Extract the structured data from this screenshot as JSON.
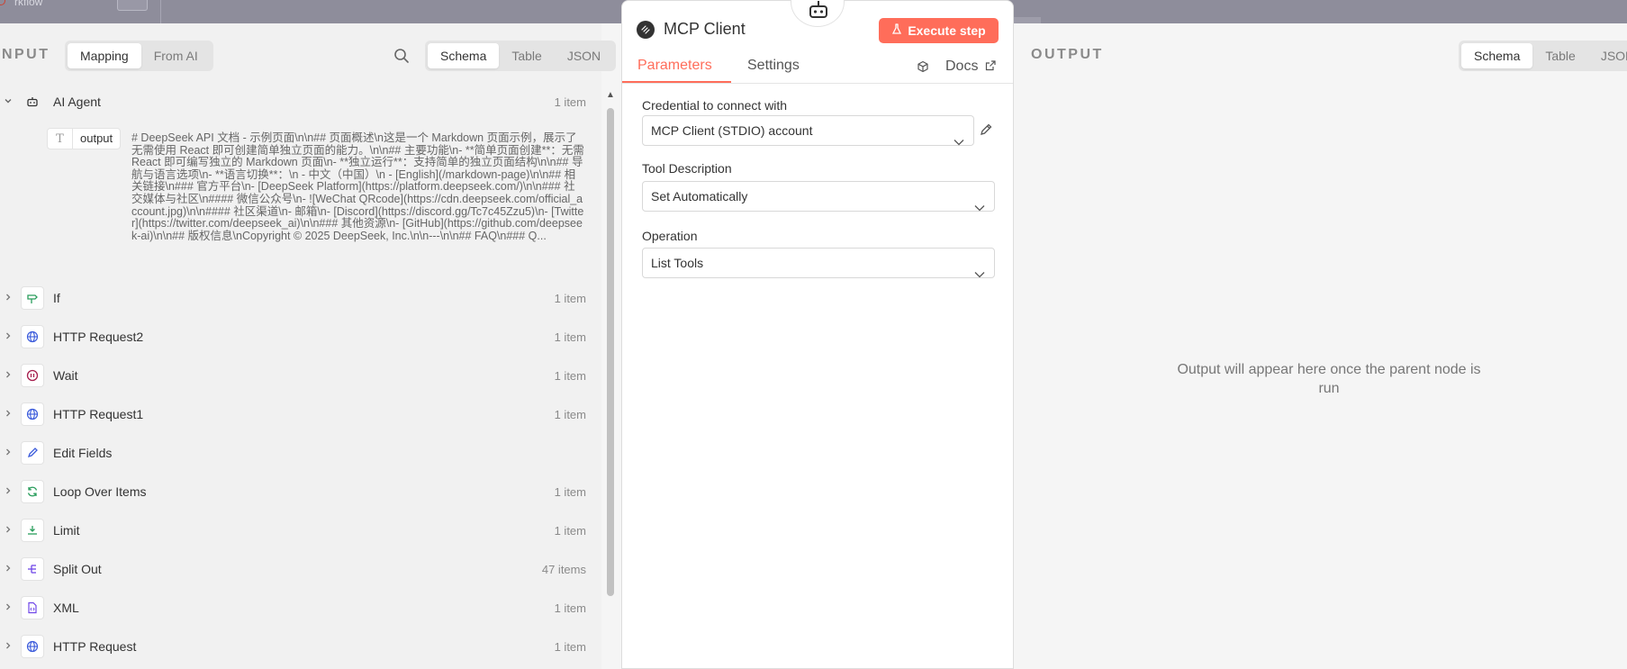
{
  "topbar": {
    "text": "rkflow"
  },
  "input_panel": {
    "label": "INPUT",
    "mode_tabs": [
      "Mapping",
      "From AI"
    ],
    "view_tabs": [
      "Schema",
      "Table",
      "JSON"
    ],
    "nodes": [
      {
        "name": "AI Agent",
        "count": "1 item",
        "icon": "robot-icon",
        "expanded": true
      },
      {
        "name": "If",
        "count": "1 item",
        "icon": "signpost-icon"
      },
      {
        "name": "HTTP Request2",
        "count": "1 item",
        "icon": "globe-icon"
      },
      {
        "name": "Wait",
        "count": "1 item",
        "icon": "pause-icon"
      },
      {
        "name": "HTTP Request1",
        "count": "1 item",
        "icon": "globe-icon"
      },
      {
        "name": "Edit Fields",
        "count": "",
        "icon": "pen-icon"
      },
      {
        "name": "Loop Over Items",
        "count": "1 item",
        "icon": "sync-icon"
      },
      {
        "name": "Limit",
        "count": "1 item",
        "icon": "limit-icon"
      },
      {
        "name": "Split Out",
        "count": "47 items",
        "icon": "split-icon"
      },
      {
        "name": "XML",
        "count": "1 item",
        "icon": "file-code-icon"
      },
      {
        "name": "HTTP Request",
        "count": "1 item",
        "icon": "globe-icon"
      }
    ],
    "output_field": {
      "type_glyph": "T",
      "name": "output",
      "value": "# DeepSeek API 文档 - 示例页面\\n\\n## 页面概述\\n这是一个 Markdown 页面示例，展示了无需使用 React 即可创建简单独立页面的能力。\\n\\n## 主要功能\\n- **简单页面创建**：无需 React 即可编写独立的 Markdown 页面\\n- **独立运行**：支持简单的独立页面结构\\n\\n## 导航与语言选项\\n- **语言切换**：\\n - 中文（中国）\\n - [English](/markdown-page)\\n\\n## 相关链接\\n### 官方平台\\n- [DeepSeek Platform](https://platform.deepseek.com/)\\n\\n### 社交媒体与社区\\n#### 微信公众号\\n- ![WeChat QRcode](https://cdn.deepseek.com/official_account.jpg)\\n\\n#### 社区渠道\\n- 邮箱\\n- [Discord](https://discord.gg/Tc7c45Zzu5)\\n- [Twitter](https://twitter.com/deepseek_ai)\\n\\n### 其他资源\\n- [GitHub](https://github.com/deepseek-ai)\\n\\n## 版权信息\\nCopyright © 2025 DeepSeek, Inc.\\n\\n---\\n\\n## FAQ\\n### Q..."
    }
  },
  "modal": {
    "title": "MCP Client",
    "execute_label": "Execute step",
    "tabs": [
      "Parameters",
      "Settings"
    ],
    "docs_label": "Docs",
    "fields": [
      {
        "label": "Credential to connect with",
        "value": "MCP Client (STDIO) account"
      },
      {
        "label": "Tool Description",
        "value": "Set Automatically"
      },
      {
        "label": "Operation",
        "value": "List Tools"
      }
    ]
  },
  "output_panel": {
    "label": "OUTPUT",
    "view_tabs": [
      "Schema",
      "Table",
      "JSON"
    ],
    "empty_message": "Output will appear here once the parent node is run"
  },
  "colors": {
    "accent": "#ff6d5a",
    "panel_bg": "#f1f1f1",
    "topbar": "#8e8d9b"
  }
}
